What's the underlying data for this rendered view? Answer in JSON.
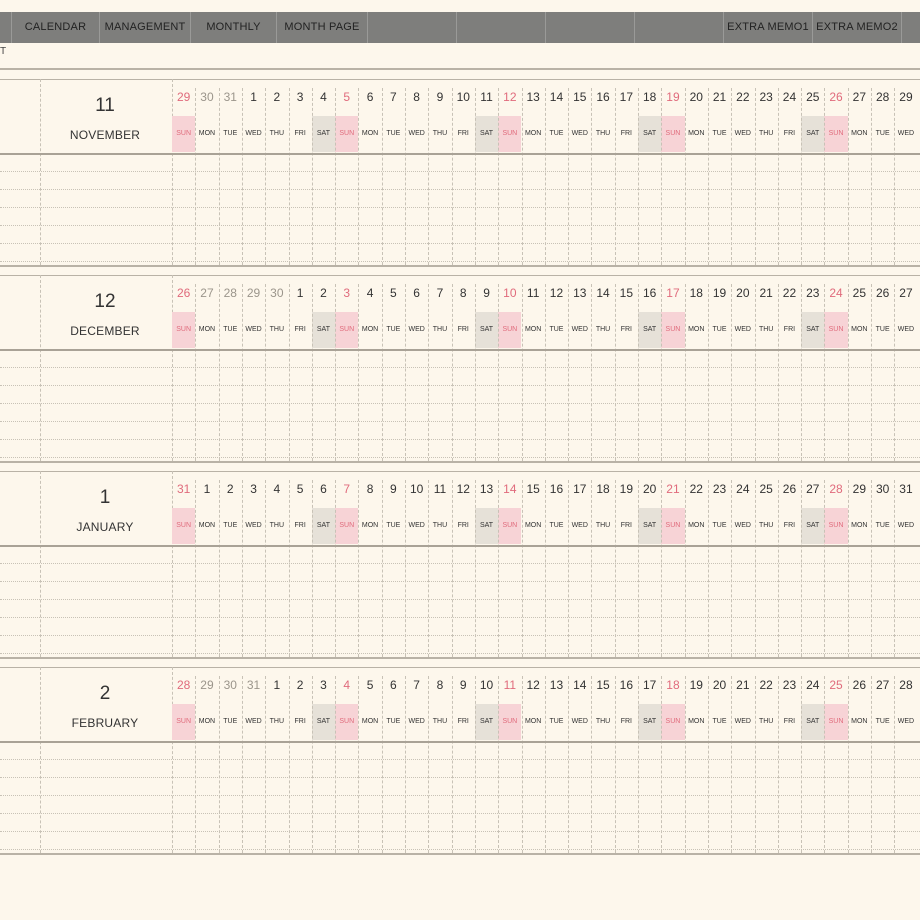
{
  "nav": {
    "tabs": [
      {
        "label": "CALENDAR"
      },
      {
        "label": "MANAGEMENT"
      },
      {
        "label": "MONTHLY"
      },
      {
        "label": "MONTH PAGE"
      },
      {
        "label": "EXTRA MEMO1"
      },
      {
        "label": "EXTRA MEMO2"
      }
    ]
  },
  "stub_text": "T",
  "weekdays": [
    "SUN",
    "MON",
    "TUE",
    "WED",
    "THU",
    "FRI",
    "SAT"
  ],
  "months": [
    {
      "number": "11",
      "name": "NOVEMBER",
      "days": [
        "29",
        "30",
        "31",
        "1",
        "2",
        "3",
        "4",
        "5",
        "6",
        "7",
        "8",
        "9",
        "10",
        "11",
        "12",
        "13",
        "14",
        "15",
        "16",
        "17",
        "18",
        "19",
        "20",
        "21",
        "22",
        "23",
        "24",
        "25",
        "26",
        "27",
        "28",
        "29"
      ],
      "other_month_count": 3
    },
    {
      "number": "12",
      "name": "DECEMBER",
      "days": [
        "26",
        "27",
        "28",
        "29",
        "30",
        "1",
        "2",
        "3",
        "4",
        "5",
        "6",
        "7",
        "8",
        "9",
        "10",
        "11",
        "12",
        "13",
        "14",
        "15",
        "16",
        "17",
        "18",
        "19",
        "20",
        "21",
        "22",
        "23",
        "24",
        "25",
        "26",
        "27"
      ],
      "other_month_count": 5
    },
    {
      "number": "1",
      "name": "JANUARY",
      "days": [
        "31",
        "1",
        "2",
        "3",
        "4",
        "5",
        "6",
        "7",
        "8",
        "9",
        "10",
        "11",
        "12",
        "13",
        "14",
        "15",
        "16",
        "17",
        "18",
        "19",
        "20",
        "21",
        "22",
        "23",
        "24",
        "25",
        "26",
        "27",
        "28",
        "29",
        "30",
        "31"
      ],
      "other_month_count": 1
    },
    {
      "number": "2",
      "name": "FEBRUARY",
      "days": [
        "28",
        "29",
        "30",
        "31",
        "1",
        "2",
        "3",
        "4",
        "5",
        "6",
        "7",
        "8",
        "9",
        "10",
        "11",
        "12",
        "13",
        "14",
        "15",
        "16",
        "17",
        "18",
        "19",
        "20",
        "21",
        "22",
        "23",
        "24",
        "25",
        "26",
        "27",
        "28"
      ],
      "other_month_count": 4
    }
  ],
  "colors": {
    "background": "#fdf7ec",
    "nav": "#7e7e7c",
    "sunday": "#e06b7c",
    "sunday_cell": "#f7d3d6",
    "saturday_cell": "#e6e1d8"
  }
}
